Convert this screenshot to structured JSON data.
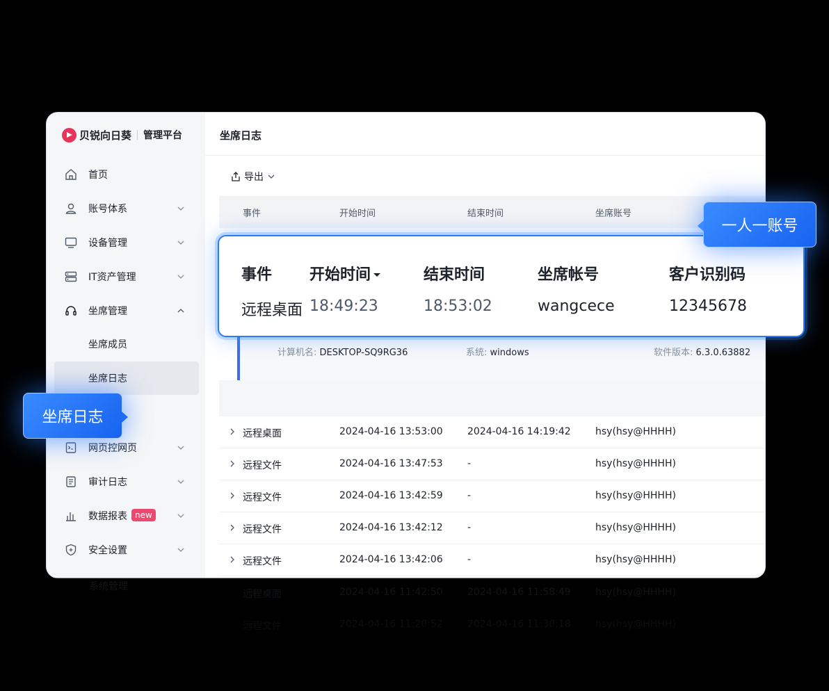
{
  "app": {
    "brand": "贝锐向日葵",
    "platform": "管理平台"
  },
  "sidebar": {
    "items": [
      {
        "label": "首页",
        "icon": "home-icon"
      },
      {
        "label": "账号体系",
        "icon": "user-icon"
      },
      {
        "label": "设备管理",
        "icon": "monitor-icon"
      },
      {
        "label": "IT资产管理",
        "icon": "server-icon"
      },
      {
        "label": "坐席管理",
        "icon": "headset-icon"
      },
      {
        "label": "坐席成员"
      },
      {
        "label": "坐席日志"
      },
      {
        "label": "网页控网页",
        "icon": "web-console-icon"
      },
      {
        "label": "审计日志",
        "icon": "document-icon"
      },
      {
        "label": "数据报表",
        "icon": "bar-chart-icon",
        "badge": "new"
      },
      {
        "label": "安全设置",
        "icon": "shield-icon"
      },
      {
        "label": "系统管理"
      }
    ]
  },
  "page": {
    "title": "坐席日志",
    "export_label": "导出"
  },
  "table": {
    "headers": [
      "事件",
      "开始时间",
      "结束时间",
      "坐席账号"
    ],
    "detail": {
      "computer_label": "计算机名:",
      "computer_value": "DESKTOP-SQ9RG36",
      "os_label": "系统:",
      "os_value": "windows",
      "version_label": "软件版本:",
      "version_value": "6.3.0.63882"
    },
    "rows": [
      {
        "event": "远程桌面",
        "start": "2024-04-16 13:53:00",
        "end": "2024-04-16 14:19:42",
        "account": "hsy(hsy@HHHH)"
      },
      {
        "event": "远程文件",
        "start": "2024-04-16 13:47:53",
        "end": "-",
        "account": "hsy(hsy@HHHH)"
      },
      {
        "event": "远程文件",
        "start": "2024-04-16 13:42:59",
        "end": "-",
        "account": "hsy(hsy@HHHH)"
      },
      {
        "event": "远程文件",
        "start": "2024-04-16 13:42:12",
        "end": "-",
        "account": "hsy(hsy@HHHH)"
      },
      {
        "event": "远程文件",
        "start": "2024-04-16 13:42:06",
        "end": "-",
        "account": "hsy(hsy@HHHH)"
      },
      {
        "event": "远程桌面",
        "start": "2024-04-16 11:42:50",
        "end": "2024-04-16 11:58:49",
        "account": "hsy(hsy@HHHH)"
      },
      {
        "event": "远程文件",
        "start": "2024-04-16 11:20:52",
        "end": "2024-04-16 11:30:18",
        "account": "hsy(hsy@HHHH)"
      }
    ]
  },
  "highlight": {
    "headers": [
      "事件",
      "开始时间",
      "结束时间",
      "坐席帐号",
      "客户识别码"
    ],
    "values": [
      "远程桌面",
      "18:49:23",
      "18:53:02",
      "wangcece",
      "12345678"
    ]
  },
  "callouts": {
    "account": "一人一账号",
    "log": "坐席日志"
  },
  "colors": {
    "brand": "#e8335a",
    "accent": "#2a7cf6",
    "badge": "#ef476f"
  }
}
